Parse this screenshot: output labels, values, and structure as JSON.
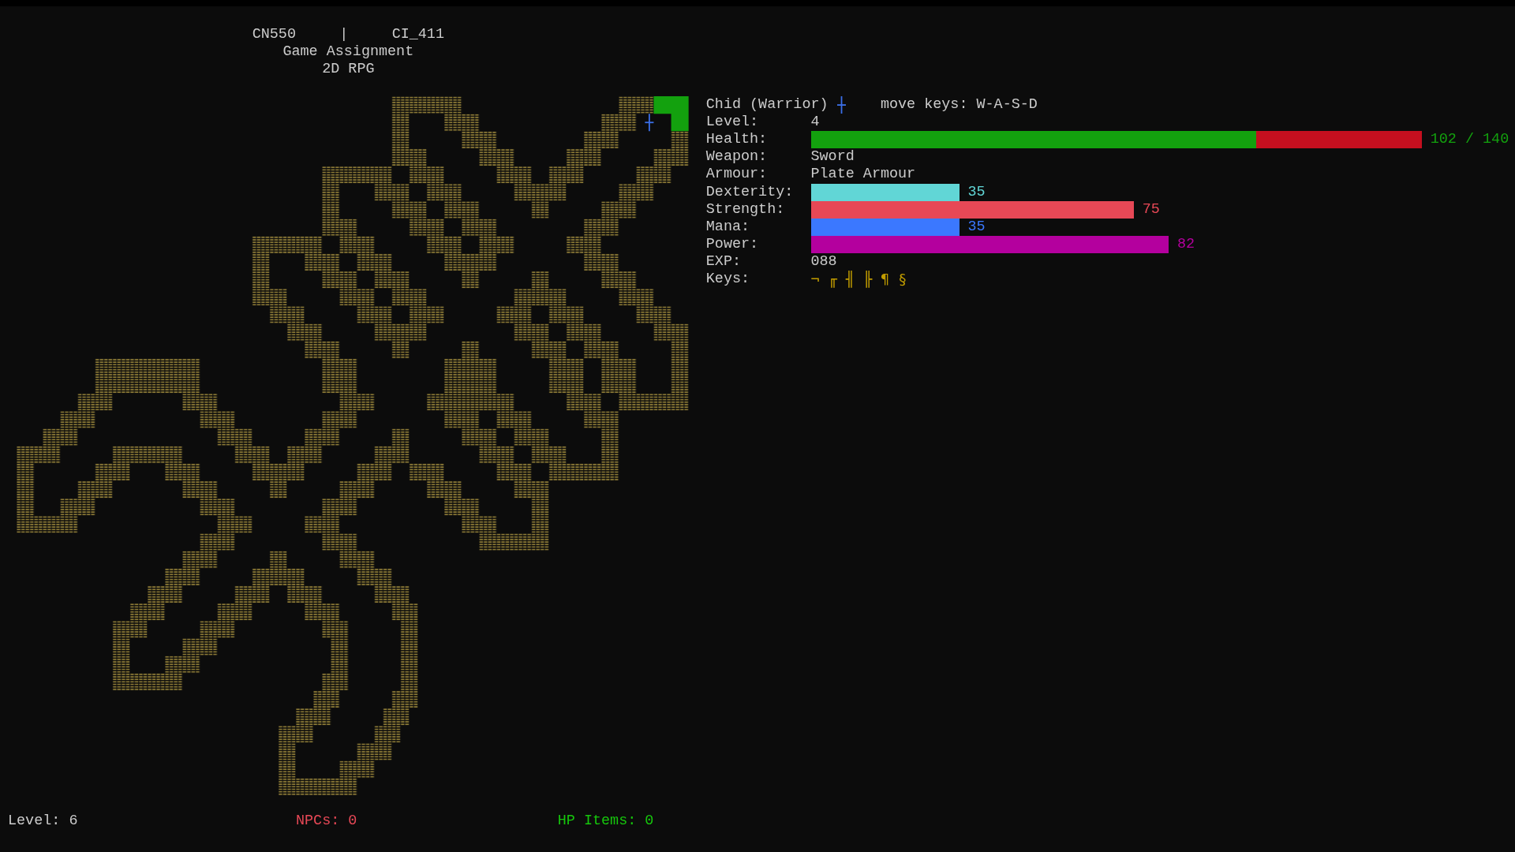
{
  "header": {
    "codes": [
      "CN550",
      "CI_411"
    ],
    "separator": "|",
    "title": "Game Assignment",
    "subtitle": "2D RPG"
  },
  "player": {
    "name": "Chid (Warrior)",
    "controls": "move keys: W-A-S-D"
  },
  "stats": [
    {
      "kind": "text",
      "label": "Level:",
      "value": "4"
    },
    {
      "kind": "health",
      "label": "Health:",
      "level": 0.7286,
      "reading": "102 / 140"
    },
    {
      "kind": "text",
      "label": "Weapon:",
      "value": "Sword"
    },
    {
      "kind": "text",
      "label": "Armour:",
      "value": "Plate Armour"
    },
    {
      "kind": "bar",
      "label": "Dexterity:",
      "reading": "35",
      "color": "#61d6d6"
    },
    {
      "kind": "bar",
      "label": "Strength:",
      "reading": "75",
      "color": "#e74856"
    },
    {
      "kind": "bar",
      "label": "Mana:",
      "reading": "35",
      "color": "#3b78ff"
    },
    {
      "kind": "bar",
      "label": "Power:",
      "reading": "82",
      "color": "#b4009e"
    },
    {
      "kind": "text",
      "label": "EXP:",
      "value": "088"
    },
    {
      "kind": "keys",
      "label": "Keys:",
      "keys": [
        "¬",
        "╓",
        "╢",
        "╟",
        "¶",
        "§"
      ]
    }
  ],
  "status_bar": [
    {
      "label": "Level: 6",
      "color": "#cccccc"
    },
    {
      "label": "NPCs: 0",
      "color": "#e74856"
    },
    {
      "label": "HP Items: 0",
      "color": "#16c60c"
    }
  ]
}
